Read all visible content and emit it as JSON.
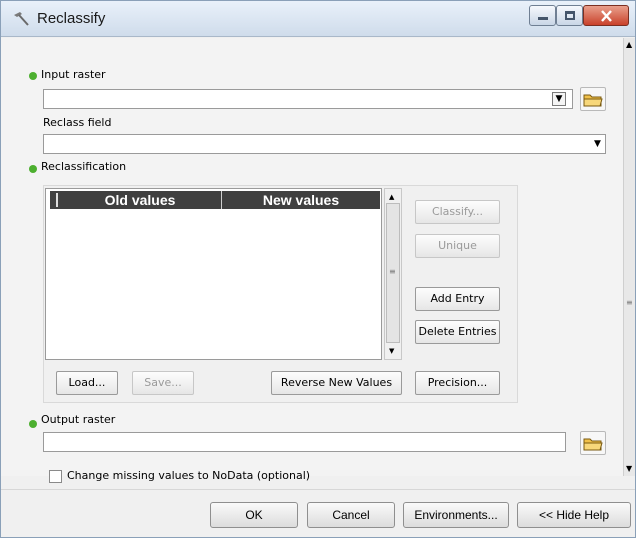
{
  "window": {
    "title": "Reclassify",
    "icon": "hammer-icon",
    "controls": {
      "minimize": "minimize-icon",
      "maximize": "maximize-icon",
      "close": "close-icon"
    }
  },
  "form": {
    "input_raster": {
      "label": "Input raster",
      "value": ""
    },
    "reclass_field": {
      "label": "Reclass field",
      "value": ""
    },
    "reclassification": {
      "label": "Reclassification",
      "columns": [
        "Old values",
        "New values"
      ],
      "rows": [],
      "buttons": {
        "classify": "Classify...",
        "unique": "Unique",
        "add_entry": "Add Entry",
        "delete_entries": "Delete Entries",
        "load": "Load...",
        "save": "Save...",
        "reverse": "Reverse New Values",
        "precision": "Precision..."
      }
    },
    "output_raster": {
      "label": "Output raster",
      "value": ""
    },
    "missing_values": {
      "label": "Change missing values to NoData (optional)",
      "checked": false
    }
  },
  "footer": {
    "ok": "OK",
    "cancel": "Cancel",
    "environments": "Environments...",
    "hide_help": "<< Hide Help"
  },
  "colors": {
    "required_bullet": "#4caf2f",
    "grid_header": "#404040",
    "close_button": "#c9422b"
  }
}
